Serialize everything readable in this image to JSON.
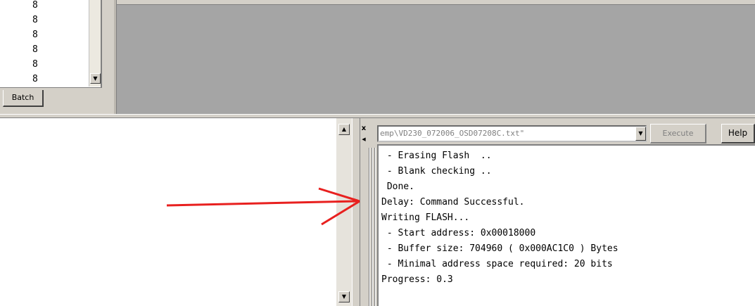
{
  "list": {
    "items": [
      "8",
      "8",
      "8",
      "8",
      "8",
      "8"
    ]
  },
  "tabs": {
    "batch_label": "Batch"
  },
  "command": {
    "value": "emp\\VD230_072006_OSD07208C.txt\"",
    "execute_label": "Execute",
    "help_label": "Help",
    "close_glyph": "x"
  },
  "output": {
    "lines": [
      " - Erasing Flash  ..",
      " - Blank checking ..",
      " Done.",
      "Delay: Command Successful.",
      "Writing FLASH...",
      " - Start address: 0x00018000",
      " - Buffer size: 704960 ( 0x000AC1C0 ) Bytes",
      " - Minimal address space required: 20 bits",
      "Progress: 0.3"
    ]
  },
  "colors": {
    "workspace": "#a5a5a5",
    "annotation_arrow": "#e8201f"
  }
}
